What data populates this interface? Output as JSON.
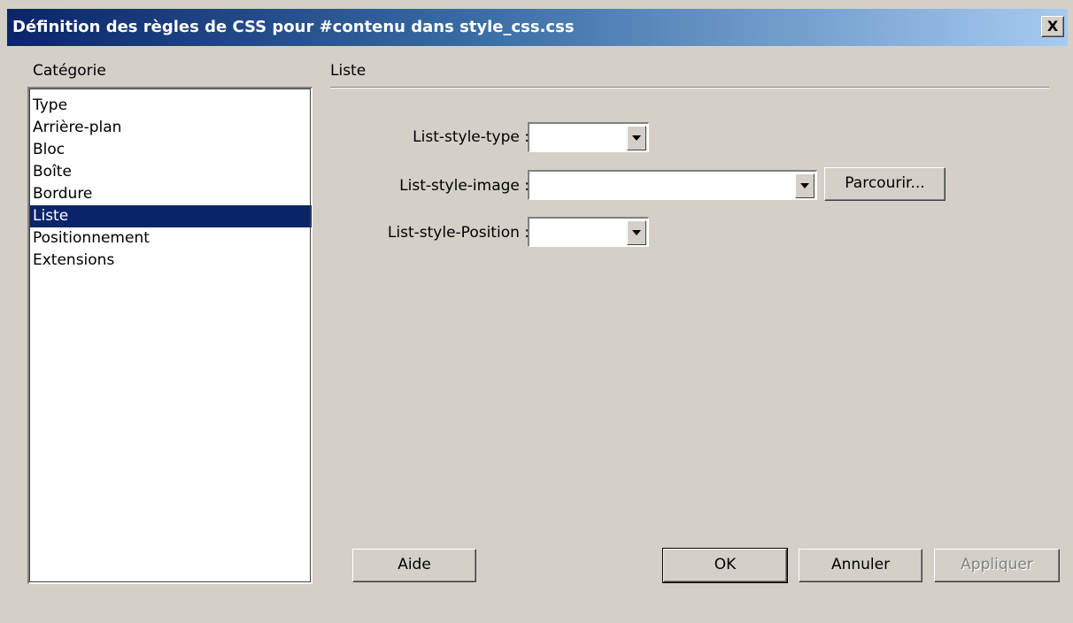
{
  "window": {
    "title": "Définition des règles de CSS pour #contenu dans style_css.css",
    "close_label": "X"
  },
  "category": {
    "label": "Catégorie",
    "items": [
      {
        "label": "Type",
        "selected": false
      },
      {
        "label": "Arrière-plan",
        "selected": false
      },
      {
        "label": "Bloc",
        "selected": false
      },
      {
        "label": "Boîte",
        "selected": false
      },
      {
        "label": "Bordure",
        "selected": false
      },
      {
        "label": "Liste",
        "selected": true
      },
      {
        "label": "Positionnement",
        "selected": false
      },
      {
        "label": "Extensions",
        "selected": false
      }
    ]
  },
  "panel": {
    "title": "Liste",
    "fields": {
      "type": {
        "label": "List-style-type :",
        "value": ""
      },
      "image": {
        "label": "List-style-image :",
        "value": "",
        "browse_label": "Parcourir..."
      },
      "position": {
        "label": "List-style-Position :",
        "value": ""
      }
    }
  },
  "buttons": {
    "help": "Aide",
    "ok": "OK",
    "cancel": "Annuler",
    "apply": "Appliquer"
  },
  "colors": {
    "title_bar_start": "#0a246a",
    "title_bar_end": "#a6caf0",
    "selection": "#0a246a",
    "dialog_bg": "#d4d0c8"
  }
}
